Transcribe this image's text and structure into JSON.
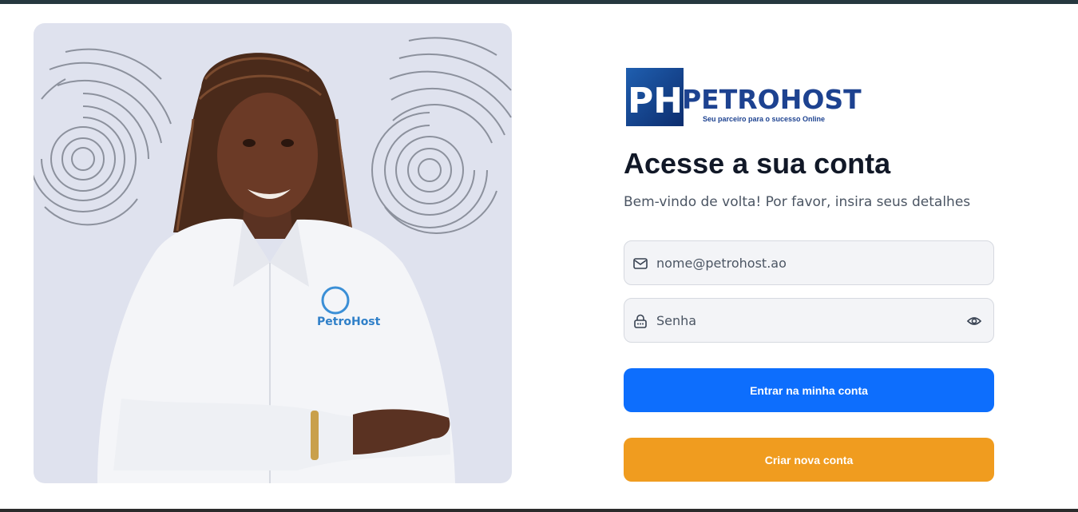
{
  "brand": {
    "name": "PETROHOST",
    "tagline": "Seu parceiro para o sucesso Online",
    "shirt_logo_text": "PetroHost",
    "colors": {
      "primary": "#1d4290",
      "accent": "#0d6efd",
      "secondary": "#f09c1f"
    }
  },
  "login": {
    "title": "Acesse a sua conta",
    "subtitle": "Bem-vindo de volta! Por favor, insira seus detalhes",
    "email_placeholder": "nome@petrohost.ao",
    "password_placeholder": "Senha",
    "submit_label": "Entrar na minha conta",
    "create_label": "Criar nova conta"
  },
  "icons": {
    "email": "mail-icon",
    "password": "lock-icon",
    "toggle": "eye-icon"
  }
}
